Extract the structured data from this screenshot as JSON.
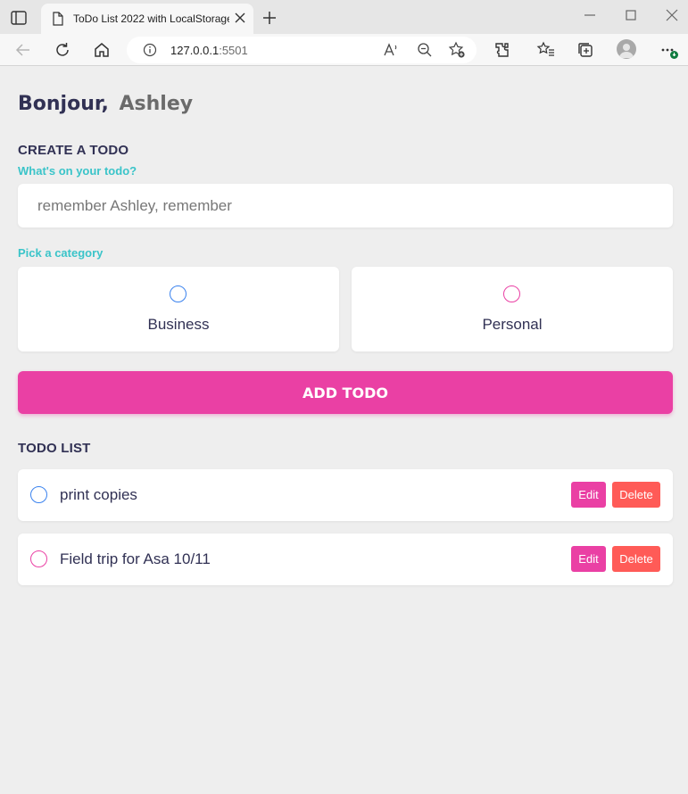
{
  "browser": {
    "tab_title": "ToDo List 2022 with LocalStorage",
    "url_host": "127.0.0.1",
    "url_port": ":5501",
    "icons": [
      "tab-actions-icon",
      "page-icon",
      "close-icon",
      "plus-icon",
      "minimize-icon",
      "maximize-icon",
      "close-window-icon",
      "back-icon",
      "refresh-icon",
      "home-icon",
      "info-icon",
      "read-aloud-icon",
      "zoom-out-icon",
      "add-favorite-icon",
      "extensions-icon",
      "favorites-icon",
      "collections-icon",
      "profile-icon",
      "more-icon"
    ]
  },
  "app": {
    "greeting": "Bonjour,",
    "username": "Ashley",
    "create_title": "CREATE A TODO",
    "input_label": "What's on your todo?",
    "input_placeholder": "remember Ashley, remember",
    "input_value": "",
    "category_label": "Pick a category",
    "categories": [
      {
        "label": "Business",
        "color": "#3a82ee",
        "selected": false
      },
      {
        "label": "Personal",
        "color": "#ea40a4",
        "selected": false
      }
    ],
    "add_button": "ADD TODO",
    "list_title": "TODO LIST",
    "todos": [
      {
        "text": "print copies",
        "category": "Business",
        "color": "#3a82ee",
        "done": false
      },
      {
        "text": "Field trip for Asa 10/11",
        "category": "Personal",
        "color": "#ea40a4",
        "done": false
      }
    ],
    "edit_label": "Edit",
    "delete_label": "Delete"
  },
  "colors": {
    "accent_pink": "#ea40a4",
    "accent_teal": "#3ac4c9",
    "business_blue": "#3a82ee",
    "delete_red": "#ff5b57",
    "dark_text": "#313154",
    "background": "#eeeeee"
  }
}
